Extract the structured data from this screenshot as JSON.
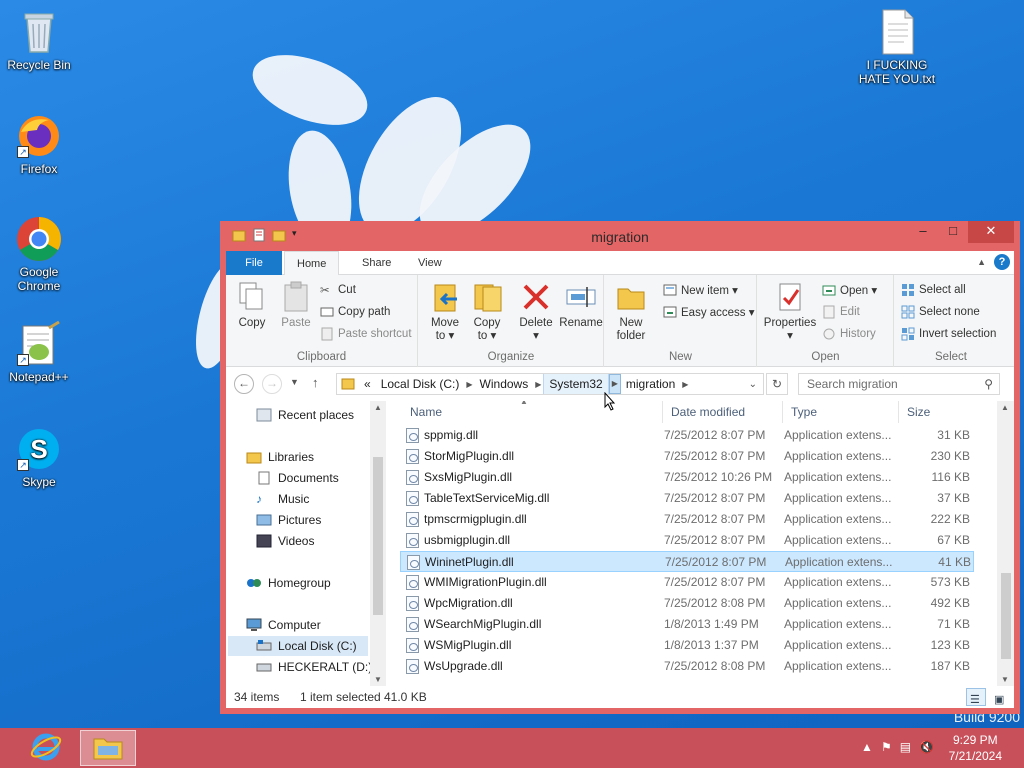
{
  "desktop": {
    "icons": [
      {
        "label": "Recycle Bin",
        "icon": "recycle-bin-icon"
      },
      {
        "label": "Firefox",
        "icon": "firefox-icon"
      },
      {
        "label": "Google Chrome",
        "icon": "chrome-icon"
      },
      {
        "label": "Notepad++",
        "icon": "notepadpp-icon"
      },
      {
        "label": "Skype",
        "icon": "skype-icon"
      },
      {
        "label": "I FUCKING HATE YOU.txt",
        "icon": "text-file-icon"
      }
    ],
    "build_text": "Build 9200"
  },
  "window": {
    "title": "migration",
    "controls": {
      "minimize": "–",
      "maximize": "□",
      "close": "✕"
    }
  },
  "ribbon": {
    "tabs": {
      "file": "File",
      "home": "Home",
      "share": "Share",
      "view": "View"
    },
    "help": "?",
    "clipboard": {
      "copy": "Copy",
      "paste": "Paste",
      "cut": "Cut",
      "copy_path": "Copy path",
      "paste_shortcut": "Paste shortcut",
      "label": "Clipboard"
    },
    "organize": {
      "move_to": "Move",
      "move_to_2": "to ▾",
      "copy_to": "Copy",
      "copy_to_2": "to ▾",
      "delete": "Delete",
      "delete_2": "▾",
      "rename": "Rename",
      "label": "Organize"
    },
    "new": {
      "new_folder": "New",
      "new_folder_2": "folder",
      "new_item": "New item ▾",
      "easy_access": "Easy access ▾",
      "label": "New"
    },
    "open": {
      "properties": "Properties",
      "properties_2": "▾",
      "open": "Open ▾",
      "edit": "Edit",
      "history": "History",
      "label": "Open"
    },
    "select": {
      "select_all": "Select all",
      "select_none": "Select none",
      "invert": "Invert selection",
      "label": "Select"
    }
  },
  "address": {
    "crumbs": {
      "overflow": "«",
      "c": "Local Disk (C:)",
      "windows": "Windows",
      "system32": "System32",
      "migration": "migration"
    },
    "search_placeholder": "Search migration"
  },
  "navpane": {
    "recent": "Recent places",
    "libraries": "Libraries",
    "documents": "Documents",
    "music": "Music",
    "pictures": "Pictures",
    "videos": "Videos",
    "homegroup": "Homegroup",
    "computer": "Computer",
    "local_disk": "Local Disk (C:)",
    "heckeralt": "HECKERALT (D:)"
  },
  "columns": {
    "name": "Name",
    "date": "Date modified",
    "type": "Type",
    "size": "Size"
  },
  "files": [
    {
      "name": "sppmig.dll",
      "date": "7/25/2012 8:07 PM",
      "type": "Application extens...",
      "size": "31 KB"
    },
    {
      "name": "StorMigPlugin.dll",
      "date": "7/25/2012 8:07 PM",
      "type": "Application extens...",
      "size": "230 KB"
    },
    {
      "name": "SxsMigPlugin.dll",
      "date": "7/25/2012 10:26 PM",
      "type": "Application extens...",
      "size": "116 KB"
    },
    {
      "name": "TableTextServiceMig.dll",
      "date": "7/25/2012 8:07 PM",
      "type": "Application extens...",
      "size": "37 KB"
    },
    {
      "name": "tpmscrmigplugin.dll",
      "date": "7/25/2012 8:07 PM",
      "type": "Application extens...",
      "size": "222 KB"
    },
    {
      "name": "usbmigplugin.dll",
      "date": "7/25/2012 8:07 PM",
      "type": "Application extens...",
      "size": "67 KB"
    },
    {
      "name": "WininetPlugin.dll",
      "date": "7/25/2012 8:07 PM",
      "type": "Application extens...",
      "size": "41 KB"
    },
    {
      "name": "WMIMigrationPlugin.dll",
      "date": "7/25/2012 8:07 PM",
      "type": "Application extens...",
      "size": "573 KB"
    },
    {
      "name": "WpcMigration.dll",
      "date": "7/25/2012 8:08 PM",
      "type": "Application extens...",
      "size": "492 KB"
    },
    {
      "name": "WSearchMigPlugin.dll",
      "date": "1/8/2013 1:49 PM",
      "type": "Application extens...",
      "size": "71 KB"
    },
    {
      "name": "WSMigPlugin.dll",
      "date": "1/8/2013 1:37 PM",
      "type": "Application extens...",
      "size": "123 KB"
    },
    {
      "name": "WsUpgrade.dll",
      "date": "7/25/2012 8:08 PM",
      "type": "Application extens...",
      "size": "187 KB"
    }
  ],
  "status": {
    "items": "34 items",
    "selected": "1 item selected",
    "size": "41.0 KB"
  },
  "taskbar": {
    "time": "9:29 PM",
    "date": "7/21/2024"
  },
  "colors": {
    "window_frame": "#e46565",
    "taskbar": "#c8505a",
    "accent": "#1979ca",
    "selection": "#cce8ff"
  }
}
